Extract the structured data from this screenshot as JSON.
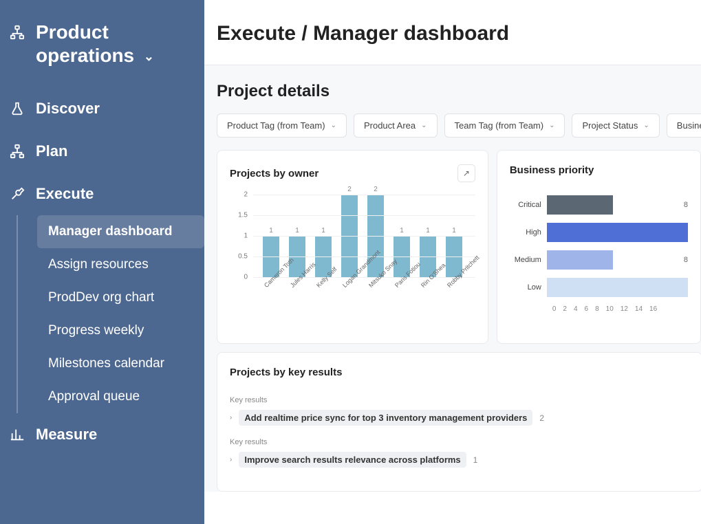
{
  "sidebar": {
    "title": "Product operations",
    "items": [
      {
        "label": "Discover",
        "icon": "flask"
      },
      {
        "label": "Plan",
        "icon": "sitemap"
      },
      {
        "label": "Execute",
        "icon": "wrench",
        "expanded": true
      },
      {
        "label": "Measure",
        "icon": "bar-chart"
      }
    ],
    "execute_sub": [
      {
        "label": "Manager dashboard",
        "active": true
      },
      {
        "label": "Assign resources"
      },
      {
        "label": "ProdDev org chart"
      },
      {
        "label": "Progress weekly"
      },
      {
        "label": "Milestones calendar"
      },
      {
        "label": "Approval queue"
      }
    ]
  },
  "breadcrumb": "Execute / Manager dashboard",
  "section_title": "Project details",
  "filters": [
    "Product Tag (from Team)",
    "Product Area",
    "Team Tag (from Team)",
    "Project Status",
    "Business P"
  ],
  "cards": {
    "owner": {
      "title": "Projects by owner"
    },
    "priority": {
      "title": "Business priority"
    },
    "keyresults": {
      "title": "Projects by key results"
    }
  },
  "key_results": [
    {
      "group": "Key results",
      "label": "Add realtime price sync for top 3 inventory management providers",
      "count": 2
    },
    {
      "group": "Key results",
      "label": "Improve search results relevance across platforms",
      "count": 1
    }
  ],
  "chart_data": [
    {
      "type": "bar",
      "title": "Projects by owner",
      "ylabel": "",
      "ylim": [
        0,
        2
      ],
      "yticks": [
        0,
        0.5,
        1,
        1.5,
        2
      ],
      "categories": [
        "Cameron Toth",
        "Jules Harris",
        "Kelly Self",
        "Logan Grandmont",
        "Mitsuko Snay",
        "Paris Fotiou",
        "Rin O'Shea",
        "Robby Pritchett"
      ],
      "values": [
        1,
        1,
        1,
        2,
        2,
        1,
        1,
        1
      ]
    },
    {
      "type": "bar",
      "orientation": "horizontal",
      "title": "Business priority",
      "xlim": [
        0,
        16
      ],
      "xticks": [
        0,
        2,
        4,
        6,
        8,
        10,
        12,
        14,
        16
      ],
      "categories": [
        "Critical",
        "High",
        "Medium",
        "Low"
      ],
      "values": [
        8,
        16,
        8,
        16
      ],
      "colors": [
        "#5b6773",
        "#4f6fd6",
        "#9fb4e8",
        "#cfe0f5"
      ]
    }
  ]
}
